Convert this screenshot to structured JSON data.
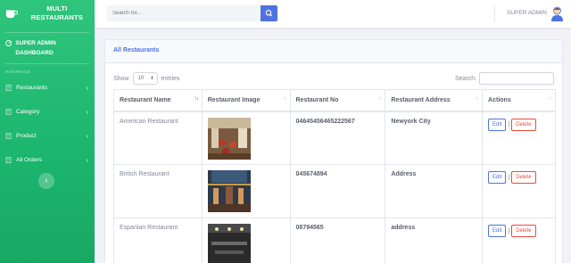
{
  "sidebar": {
    "brand": "MULTI RESTAURANTS",
    "dashboard": "SUPER ADMIN DASHBOARD",
    "section": "INTERFACE",
    "items": [
      {
        "label": "Restaurants",
        "icon": "file-icon"
      },
      {
        "label": "Category",
        "icon": "file-icon"
      },
      {
        "label": "Product",
        "icon": "file-icon"
      },
      {
        "label": "All Orders",
        "icon": "file-icon"
      }
    ],
    "toggle": "‹"
  },
  "topbar": {
    "search_placeholder": "Search for...",
    "user": "SUPER ADMIN"
  },
  "card": {
    "title": "All Restaurants",
    "show": "Show",
    "entries_value": "10",
    "entries": "entries",
    "search_label": "Search:"
  },
  "table": {
    "headers": [
      "Restaurant Name",
      "Restaurant Image",
      "Restaurant No",
      "Restaurant Address",
      "Actions"
    ],
    "rows": [
      {
        "name": "American Restaurant",
        "no": "04645456465222567",
        "address": "Newyork City"
      },
      {
        "name": "British Restaurant",
        "no": "045674894",
        "address": "Address"
      },
      {
        "name": "Espanian Restaurant",
        "no": "08794565",
        "address": "address"
      }
    ],
    "edit_label": "Edit",
    "delete_label": "Delete",
    "separator": "|"
  },
  "colors": {
    "sidebar": "#1cc88a",
    "primary": "#4e73df",
    "danger": "#e74a3b"
  }
}
